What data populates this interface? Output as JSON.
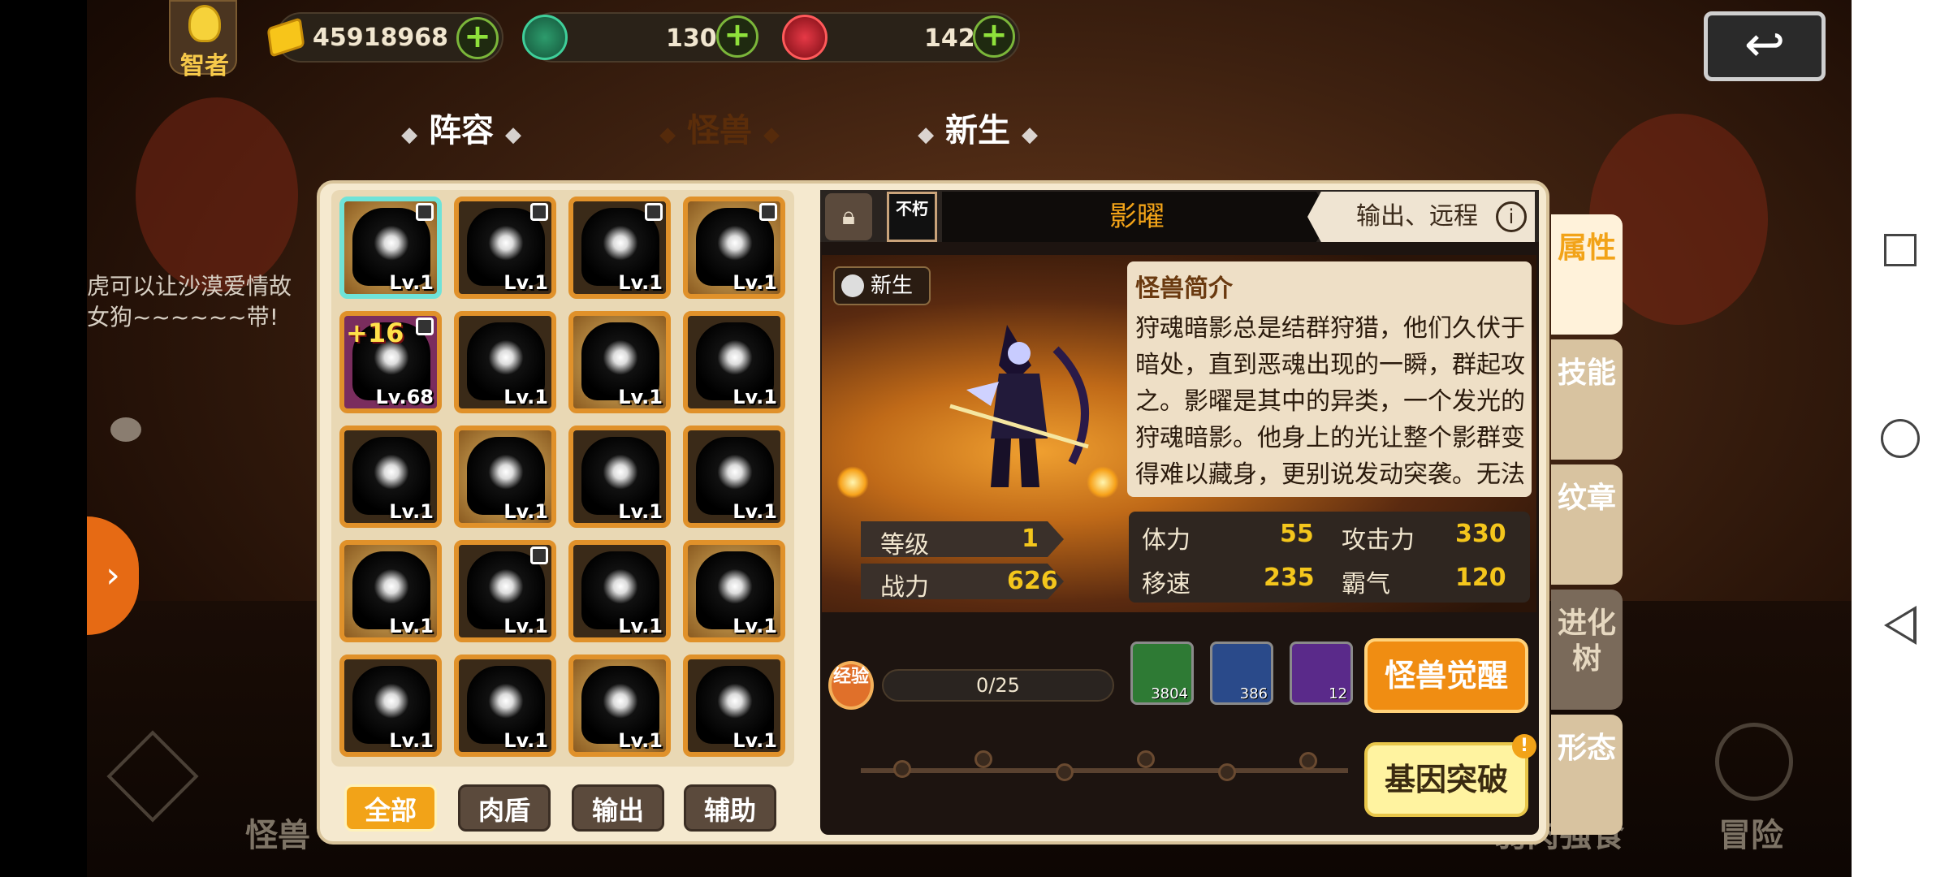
{
  "topbar": {
    "sage_label": "智者",
    "gold": "45918968",
    "green_gem": "130",
    "red_gem": "142",
    "back_icon": "back-arrow-icon"
  },
  "tabs": [
    {
      "label": "阵容",
      "active": false
    },
    {
      "label": "怪兽",
      "active": true
    },
    {
      "label": "新生",
      "active": false
    }
  ],
  "chat_text": [
    "虎可以让沙漠爱情故",
    "女狗~~~~~~带!"
  ],
  "monster_grid": [
    {
      "lv": "Lv.1",
      "locked": true,
      "selected": true
    },
    {
      "lv": "Lv.1",
      "locked": true
    },
    {
      "lv": "Lv.1",
      "locked": true
    },
    {
      "lv": "Lv.1",
      "locked": true
    },
    {
      "lv": "Lv.68",
      "locked": true,
      "plus": "+16"
    },
    {
      "lv": "Lv.1"
    },
    {
      "lv": "Lv.1"
    },
    {
      "lv": "Lv.1"
    },
    {
      "lv": "Lv.1"
    },
    {
      "lv": "Lv.1"
    },
    {
      "lv": "Lv.1"
    },
    {
      "lv": "Lv.1"
    },
    {
      "lv": "Lv.1"
    },
    {
      "lv": "Lv.1",
      "locked": true
    },
    {
      "lv": "Lv.1"
    },
    {
      "lv": "Lv.1"
    },
    {
      "lv": "Lv.1"
    },
    {
      "lv": "Lv.1"
    },
    {
      "lv": "Lv.1"
    },
    {
      "lv": "Lv.1"
    }
  ],
  "filters": [
    "全部",
    "肉盾",
    "输出",
    "辅助"
  ],
  "detail": {
    "badge": "不朽",
    "name": "影曜",
    "role": "输出、远程",
    "newborn_label": "新生",
    "intro_title": "怪兽简介",
    "intro_text": "狩魂暗影总是结群狩猎，他们久伏于暗处，直到恶魂出现的一瞬，群起攻之。影曜是其中的异类，一个发光的狩魂暗影。他身上的光让整个影群变得难以藏身，更别说发动突袭。无法狩猎的暗影注定被驱逐",
    "level_label": "等级",
    "level_value": "1",
    "power_label": "战力",
    "power_value": "626",
    "stats": [
      {
        "label": "体力",
        "value": "55"
      },
      {
        "label": "攻击力",
        "value": "330"
      },
      {
        "label": "移速",
        "value": "235"
      },
      {
        "label": "霸气",
        "value": "120"
      }
    ],
    "exp_badge": "经验",
    "exp_progress": "0/25",
    "foods": [
      {
        "name": "vegetable-icon",
        "count": "3804",
        "color": "#2e7a34"
      },
      {
        "name": "ham-icon",
        "count": "386",
        "color": "#2a4a8a"
      },
      {
        "name": "steak-icon",
        "count": "12",
        "color": "#5a2a8a"
      }
    ],
    "awaken_label": "怪兽觉醒",
    "gene_label": "基因突破",
    "gene_alert": "!"
  },
  "side_tabs": [
    {
      "label": "属性",
      "active": true
    },
    {
      "label": "技能"
    },
    {
      "label": "纹章"
    },
    {
      "label": "进化树"
    },
    {
      "label": "形态"
    }
  ],
  "bottom_nav": {
    "monster": "怪兽",
    "devour": "弱肉强食",
    "adventure": "冒险"
  }
}
